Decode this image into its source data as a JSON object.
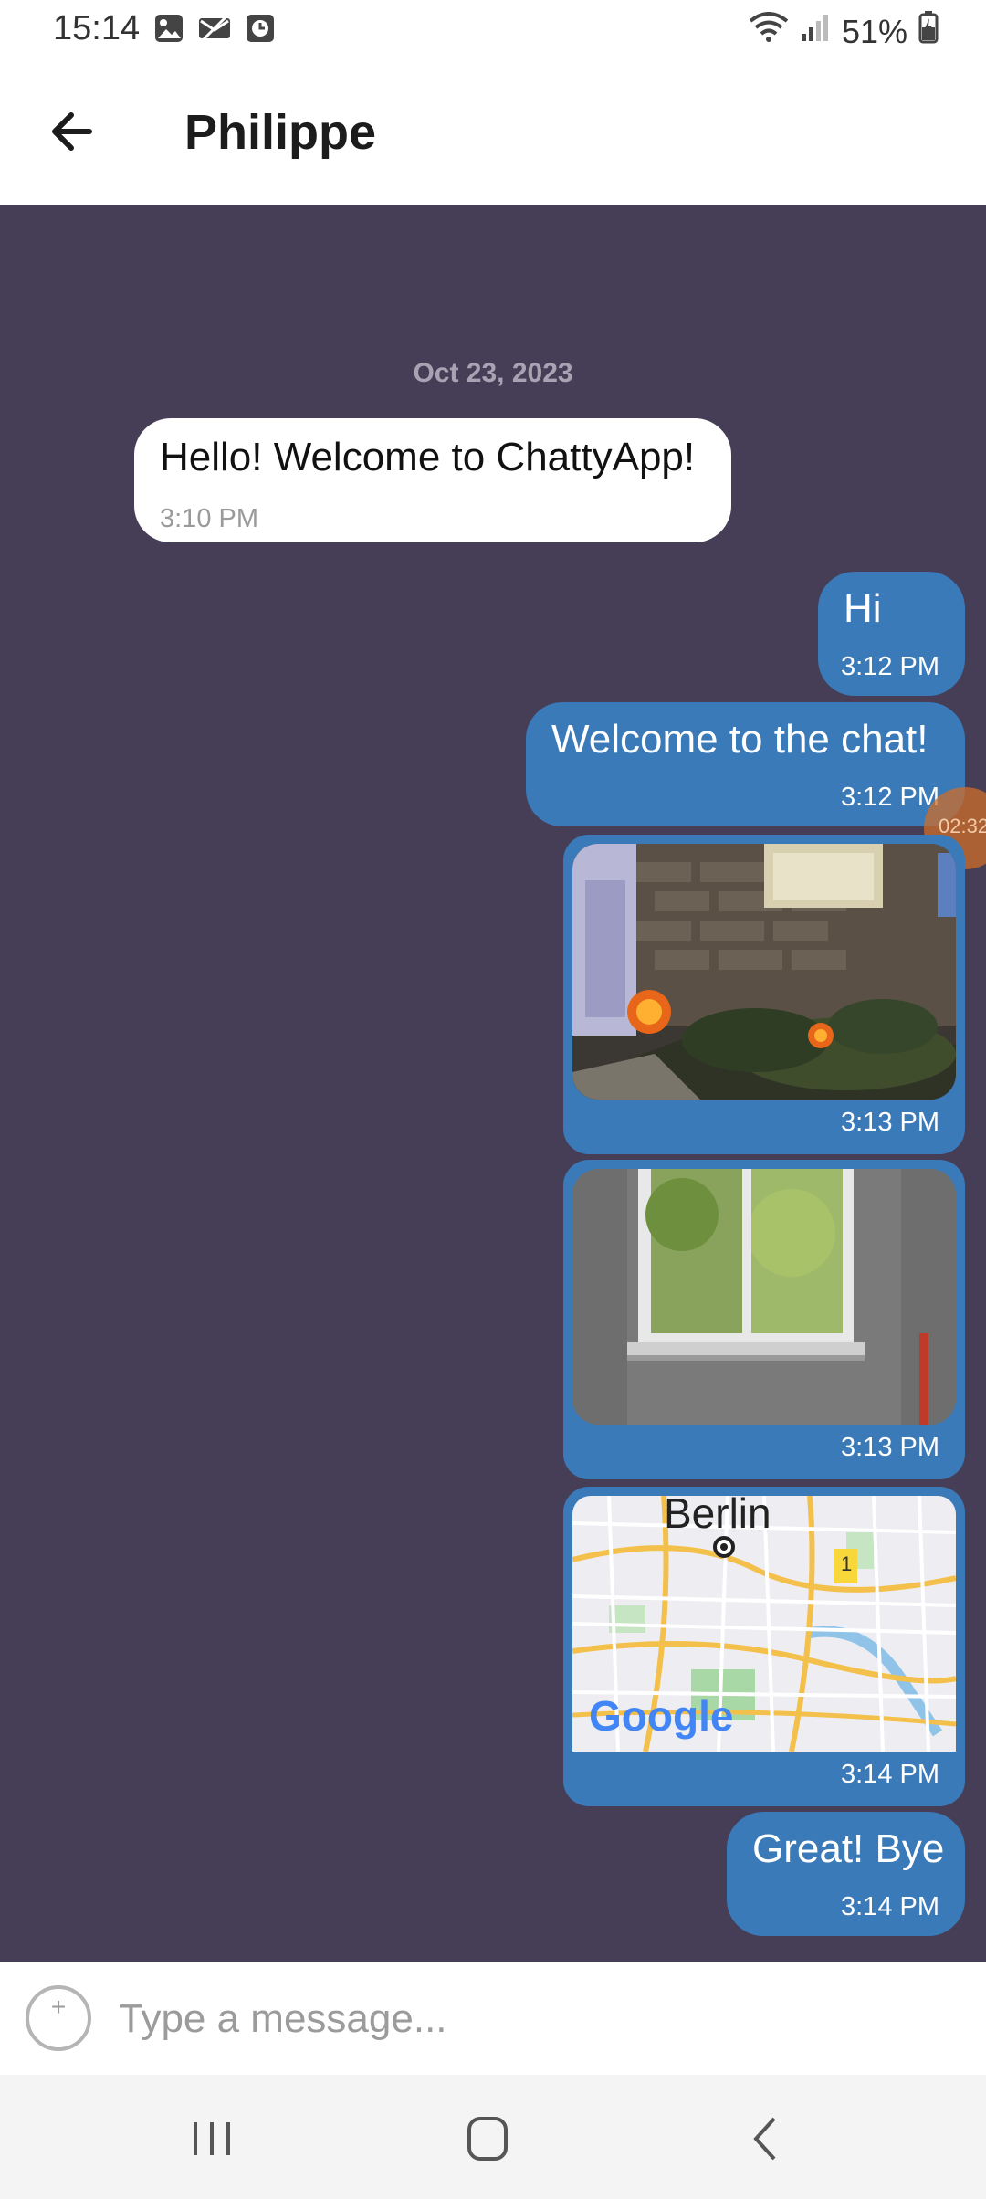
{
  "status_bar": {
    "time": "15:14",
    "battery": "51%",
    "icons": [
      "image-notification-icon",
      "mail-off-icon",
      "clock-notification-icon",
      "wifi-icon",
      "signal-icon",
      "battery-charging-icon"
    ]
  },
  "header": {
    "title": "Philippe",
    "back_icon": "arrow-left-icon"
  },
  "chat": {
    "date": "Oct 23, 2023",
    "scroll_indicator": "02:32",
    "messages": [
      {
        "direction": "incoming",
        "type": "text",
        "text": "Hello! Welcome to ChattyApp!",
        "time": "3:10 PM"
      },
      {
        "direction": "outgoing",
        "type": "text",
        "text": "Hi",
        "time": "3:12 PM"
      },
      {
        "direction": "outgoing",
        "type": "text",
        "text": "Welcome to the chat!",
        "time": "3:12 PM"
      },
      {
        "direction": "outgoing",
        "type": "image",
        "content": "night garden with jack-o-lanterns",
        "time": "3:13 PM"
      },
      {
        "direction": "outgoing",
        "type": "image",
        "content": "window in white wall",
        "time": "3:13 PM"
      },
      {
        "direction": "outgoing",
        "type": "location",
        "map_city": "Berlin",
        "map_marker": "1",
        "map_brand": "Google",
        "time": "3:14 PM"
      },
      {
        "direction": "outgoing",
        "type": "text",
        "text": "Great! Bye",
        "time": "3:14 PM"
      }
    ]
  },
  "composer": {
    "placeholder": "Type a message...",
    "add_icon": "plus-circle-icon"
  },
  "colors": {
    "chat_background": "#463e56",
    "outgoing_bubble": "#3a7ab8",
    "incoming_bubble": "#ffffff"
  }
}
